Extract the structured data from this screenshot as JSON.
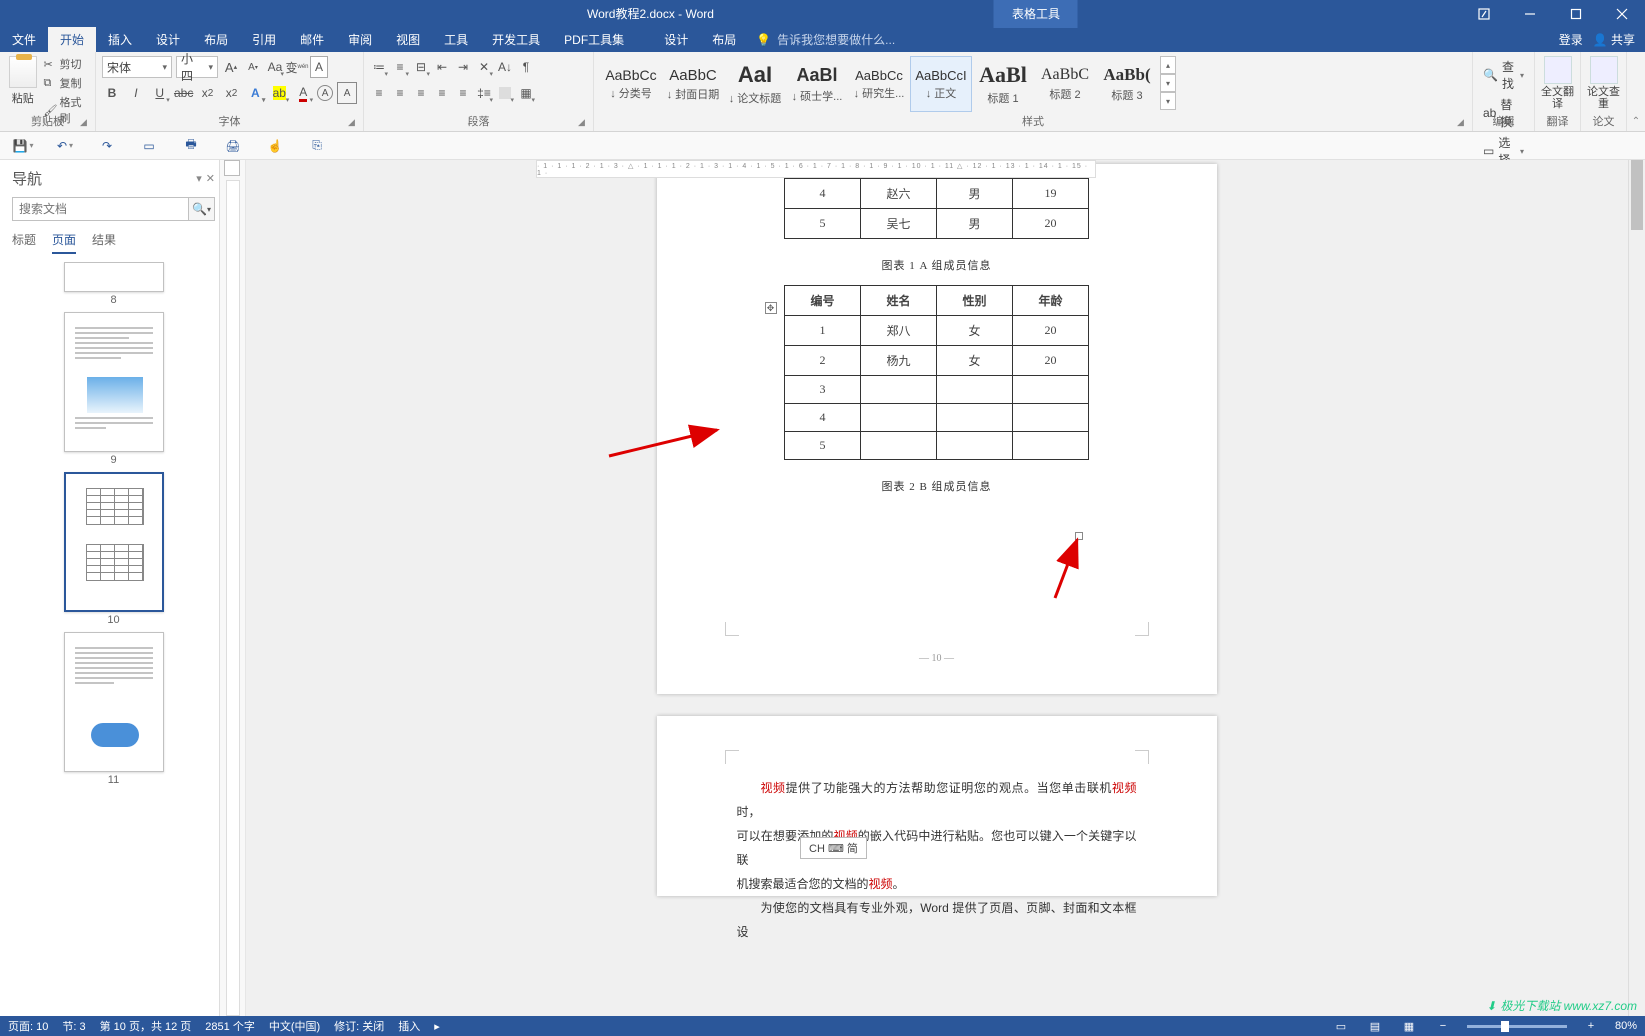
{
  "titlebar": {
    "doc_title": "Word教程2.docx - Word",
    "table_tools": "表格工具"
  },
  "tabs": {
    "file": "文件",
    "home": "开始",
    "insert": "插入",
    "design": "设计",
    "layout": "布局",
    "references": "引用",
    "mailings": "邮件",
    "review": "审阅",
    "view": "视图",
    "tools": "工具",
    "developer": "开发工具",
    "pdf": "PDF工具集",
    "ctx_design": "设计",
    "ctx_layout": "布局",
    "tell_me": "告诉我您想要做什么...",
    "login": "登录",
    "share": "共享"
  },
  "ribbon": {
    "clipboard": {
      "paste": "粘贴",
      "cut": "剪切",
      "copy": "复制",
      "format_painter": "格式刷",
      "group": "剪贴板"
    },
    "font": {
      "name": "宋体",
      "size": "小四",
      "buttons": {
        "bold": "B",
        "italic": "I",
        "underline": "U"
      },
      "group": "字体"
    },
    "paragraph": {
      "group": "段落"
    },
    "styles": {
      "group": "样式",
      "items": [
        {
          "sample": "AaBbCc",
          "label": "↓ 分类号"
        },
        {
          "sample": "AaBbC",
          "label": "↓ 封面日期"
        },
        {
          "sample": "AaI",
          "label": "↓ 论文标题"
        },
        {
          "sample": "AaBl",
          "label": "↓ 硕士学..."
        },
        {
          "sample": "AaBbCc",
          "label": "↓ 研究生..."
        },
        {
          "sample": "AaBbCcI",
          "label": "↓ 正文"
        },
        {
          "sample": "AaBl",
          "label": "标题 1"
        },
        {
          "sample": "AaBbC",
          "label": "标题 2"
        },
        {
          "sample": "AaBb(",
          "label": "标题 3"
        }
      ],
      "selected_index": 5
    },
    "editing": {
      "find": "查找",
      "replace": "替换",
      "select": "选择",
      "group": "编辑"
    },
    "translate": {
      "label": "全文翻译",
      "group": "翻译"
    },
    "check": {
      "label": "论文查重",
      "group": "论文"
    }
  },
  "nav": {
    "title": "导航",
    "search_placeholder": "搜索文档",
    "tab_headings": "标题",
    "tab_pages": "页面",
    "tab_results": "结果",
    "pages": [
      "8",
      "9",
      "10",
      "11"
    ],
    "selected_page": "10"
  },
  "document": {
    "table_a_rows": [
      [
        "4",
        "赵六",
        "男",
        "19"
      ],
      [
        "5",
        "吴七",
        "男",
        "20"
      ]
    ],
    "caption_a": "图表 1  A 组成员信息",
    "table_b_header": [
      "编号",
      "姓名",
      "性别",
      "年龄"
    ],
    "table_b_rows": [
      [
        "1",
        "郑八",
        "女",
        "20"
      ],
      [
        "2",
        "杨九",
        "女",
        "20"
      ],
      [
        "3",
        "",
        "",
        ""
      ],
      [
        "4",
        "",
        "",
        ""
      ],
      [
        "5",
        "",
        "",
        ""
      ]
    ],
    "caption_b": "图表 2  B 组成员信息",
    "page_number": "— 10 —",
    "body1_kw1": "视频",
    "body1_a": "提供了功能强大的方法帮助您证明您的观点。当您单击联机",
    "body1_kw2": "视频",
    "body1_b": "时，",
    "body2_a": "可以在想要添加的",
    "body2_kw": "视频",
    "body2_b": "的嵌入代码中进行粘贴。您也可以键入一个关键字以联",
    "body3_a": "机搜索最适合您的文档的",
    "body3_kw": "视频",
    "body3_b": "。",
    "body4": "为使您的文档具有专业外观，Word 提供了页眉、页脚、封面和文本框设"
  },
  "ime": "CH ⌨ 简",
  "status": {
    "page": "页面: 10",
    "section": "节: 3",
    "page_of": "第 10 页，共 12 页",
    "words": "2851 个字",
    "lang": "中文(中国)",
    "track": "修订: 关闭",
    "insert": "插入",
    "zoom": "80%",
    "zoom_plus": "+",
    "zoom_minus": "−"
  },
  "watermark": "极光下载站 www.xz7.com"
}
